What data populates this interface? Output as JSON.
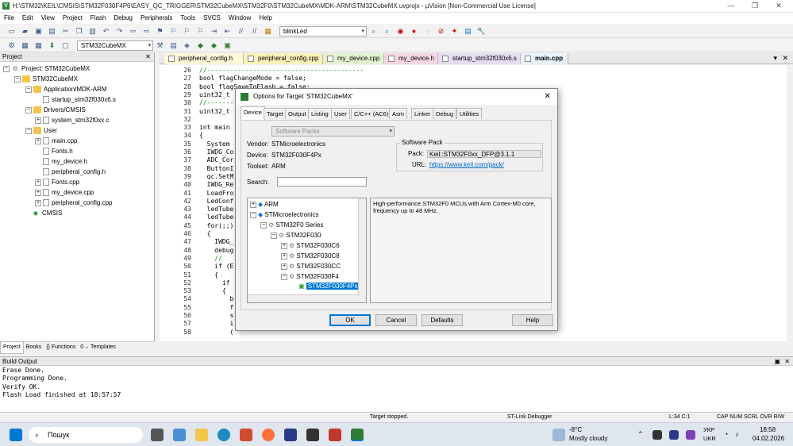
{
  "window": {
    "title": "H:\\STM32\\KEIL\\CMSIS\\STM32F030F4P6\\EASY_QC_TRIGGER\\STM32CubeMX\\STM32F0\\STM32CubeMX\\MDK-ARM\\STM32CubeMX.uvprojx - µVision  [Non-Commercial Use License]"
  },
  "menu": [
    "File",
    "Edit",
    "View",
    "Project",
    "Flash",
    "Debug",
    "Peripherals",
    "Tools",
    "SVCS",
    "Window",
    "Help"
  ],
  "toolbar": {
    "function_combo": "blinkLed",
    "target_combo": "STM32CubeMX"
  },
  "project": {
    "header": "Project",
    "root": "Project: STM32CubeMX",
    "target": "STM32CubeMX",
    "items": [
      {
        "label": "Application/MDK-ARM",
        "kind": "folder"
      },
      {
        "label": "startup_stm32f030x6.s",
        "kind": "file"
      },
      {
        "label": "Drivers/CMSIS",
        "kind": "folder"
      },
      {
        "label": "system_stm32f0xx.c",
        "kind": "file"
      },
      {
        "label": "User",
        "kind": "folder"
      },
      {
        "label": "main.cpp",
        "kind": "file"
      },
      {
        "label": "Fonts.h",
        "kind": "file"
      },
      {
        "label": "my_device.h",
        "kind": "file"
      },
      {
        "label": "peripheral_config.h",
        "kind": "file"
      },
      {
        "label": "Fonts.cpp",
        "kind": "file"
      },
      {
        "label": "my_device.cpp",
        "kind": "file"
      },
      {
        "label": "peripheral_config.cpp",
        "kind": "file"
      },
      {
        "label": "CMSIS",
        "kind": "gem"
      }
    ],
    "tabs": [
      "Project",
      "Books",
      "{} Functions",
      "0→ Templates"
    ]
  },
  "editor_tabs": [
    "peripheral_config.h",
    "peripheral_config.cpp",
    "my_device.cpp",
    "my_device.h",
    "startup_stm32f030x6.s",
    "main.cpp"
  ],
  "code": [
    {
      "n": "26",
      "t": "//-----------------------------------------"
    },
    {
      "n": "27",
      "t": "bool flagChangeMode = false;"
    },
    {
      "n": "28",
      "t": "bool flagSaveToFlash = false;"
    },
    {
      "n": "29",
      "t": "uint32_t"
    },
    {
      "n": "30",
      "t": "//-------"
    },
    {
      "n": "31",
      "t": "uint32_t"
    },
    {
      "n": "32",
      "t": ""
    },
    {
      "n": "33",
      "t": "int main"
    },
    {
      "n": "34",
      "t": "{"
    },
    {
      "n": "35",
      "t": "  System"
    },
    {
      "n": "36",
      "t": "  IWDG_Co"
    },
    {
      "n": "37",
      "t": "  ADC_Cor"
    },
    {
      "n": "38",
      "t": "  ButtonI"
    },
    {
      "n": "39",
      "t": "  qc.SetM"
    },
    {
      "n": "40",
      "t": "  IWDG_Re"
    },
    {
      "n": "41",
      "t": "  LoadFro"
    },
    {
      "n": "42",
      "t": "  LedConf"
    },
    {
      "n": "43",
      "t": "  ledTube"
    },
    {
      "n": "44",
      "t": "  ledTube"
    },
    {
      "n": "45",
      "t": "  for(;;)"
    },
    {
      "n": "46",
      "t": "  {"
    },
    {
      "n": "47",
      "t": "    IWDG_"
    },
    {
      "n": "48",
      "t": "    debug"
    },
    {
      "n": "49",
      "t": "    //"
    },
    {
      "n": "50",
      "t": "    if (E"
    },
    {
      "n": "51",
      "t": "    {"
    },
    {
      "n": "52",
      "t": "      if"
    },
    {
      "n": "53",
      "t": "      {"
    },
    {
      "n": "54",
      "t": "        b"
    },
    {
      "n": "55",
      "t": "        f"
    },
    {
      "n": "56",
      "t": "        s"
    },
    {
      "n": "57",
      "t": "        i"
    },
    {
      "n": "58",
      "t": "        ("
    }
  ],
  "dialog": {
    "title": "Options for Target 'STM32CubeMX'",
    "tabs": [
      "Device",
      "Target",
      "Output",
      "Listing",
      "User",
      "C/C++ (AC6)",
      "Asm",
      "Linker",
      "Debug",
      "Utilities"
    ],
    "pack_combo": "Software Packs",
    "vendor_label": "Vendor:",
    "vendor": "STMicroelectronics",
    "device_label": "Device:",
    "device": "STM32F030F4Px",
    "toolset_label": "Toolset:",
    "toolset": "ARM",
    "search_label": "Search:",
    "software_pack": {
      "group": "Software Pack",
      "pack_label": "Pack:",
      "pack": "Keil::STM32F0xx_DFP@3.1.1",
      "url_label": "URL:",
      "url": "https://www.keil.com/pack/"
    },
    "tree": [
      "ARM",
      "STMicroelectronics",
      "STM32F0 Series",
      "STM32F030",
      "STM32F030C6",
      "STM32F030C8",
      "STM32F030CC",
      "STM32F030F4",
      "STM32F030F4Px"
    ],
    "description": "High-performance STM32F0 MCUs with Arm Cortex-M0 core, frequency up to 48 MHz.",
    "buttons": {
      "ok": "OK",
      "cancel": "Cancel",
      "defaults": "Defaults",
      "help": "Help"
    }
  },
  "build": {
    "header": "Build Output",
    "lines": [
      "Erase Done.",
      "Programming Done.",
      "Verify OK.",
      "Flash Load finished at 18:57:57"
    ]
  },
  "status": {
    "message": "Target stopped.",
    "debugger": "ST-Link Debugger",
    "pos": "L:34 C:1",
    "indicators": "CAP  NUM  SCRL  OVR  R/W"
  },
  "taskbar": {
    "search": "Пошук",
    "temp": "-8°C",
    "weather": "Mostly cloudy",
    "lang1": "УКР",
    "lang2": "UKR",
    "time": "18:58",
    "date": "04.02.2026"
  },
  "colors": {
    "accent": "#0078d7",
    "selection": "#0078d7",
    "keyword": "#0000ff"
  }
}
